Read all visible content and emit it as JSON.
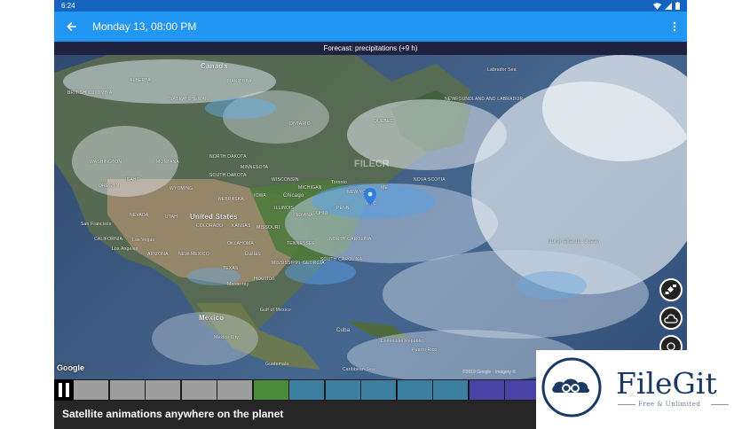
{
  "status_bar": {
    "time": "6:24"
  },
  "app_bar": {
    "title": "Monday 13, 08:00 PM"
  },
  "forecast_label": "Forecast: precipitations (+9 h)",
  "map": {
    "watermark": "FILECR",
    "google": "Google",
    "attribution": "©2019 Google · Imagery ©",
    "labels": {
      "canada": "Canada",
      "alberta": "ALBERTA",
      "manitoba": "MANITOBA",
      "saskatchewan": "SASKATCHEWAN",
      "british_columbia": "BRITISH COLUMBIA",
      "ontario": "ONTARIO",
      "quebec": "QUEBEC",
      "labrador_sea": "Labrador Sea",
      "newfoundland": "NEWFOUNDLAND AND LABRADOR",
      "washington": "WASHINGTON",
      "oregon": "OREGON",
      "montana": "MONTANA",
      "north_dakota": "NORTH DAKOTA",
      "minnesota": "MINNESOTA",
      "south_dakota": "SOUTH DAKOTA",
      "wisconsin": "WISCONSIN",
      "idaho": "IDAHO",
      "wyoming": "WYOMING",
      "nebraska": "NEBRASKA",
      "iowa": "IOWA",
      "michigan": "MICHIGAN",
      "toronto": "Toronto",
      "new_york": "NEW YORK",
      "nova_scotia": "NOVA SCOTIA",
      "maine": "ME",
      "nevada": "NEVADA",
      "utah": "UTAH",
      "colorado": "COLORADO",
      "kansas": "KANSAS",
      "missouri": "MISSOURI",
      "illinois": "ILLINOIS",
      "chicago": "Chicago",
      "indiana": "INDIANA",
      "ohio": "OHIO",
      "penn": "PENN",
      "nyc": "NYC",
      "united_states": "United States",
      "san_francisco": "San Francisco",
      "california": "CALIFORNIA",
      "las_vegas": "Las Vegas",
      "los_angeles": "Los Angeles",
      "arizona": "ARIZONA",
      "new_mexico": "NEW MEXICO",
      "oklahoma": "OKLAHOMA",
      "tennessee": "TENNESSEE",
      "north_carolina": "NORTH CAROLINA",
      "south_carolina": "SOUTH CAROLINA",
      "dallas": "Dallas",
      "texas": "TEXAS",
      "houston": "Houston",
      "georgia": "GEORGIA",
      "mississippi": "MISSISSIPPI",
      "north_atlantic": "North Atlantic Ocean",
      "monterrey": "Monterrey",
      "mexico_label": "Mexico",
      "gulf_of_mexico": "Gulf of Mexico",
      "mexico_city": "Mexico City",
      "cuba": "Cuba",
      "dominican": "Dominican Republic",
      "puerto_rico": "Puerto Rico",
      "guatemala": "Guatemala",
      "caribbean": "Caribbean Sea"
    }
  },
  "timeline": {
    "segments": [
      "#9e9e9e",
      "#9e9e9e",
      "#9e9e9e",
      "#9e9e9e",
      "#9e9e9e",
      "#4a8c3c",
      "#3c7fa0",
      "#3c7fa0",
      "#3c7fa0",
      "#3c7fa0",
      "#3c7fa0",
      "#4a44a8",
      "#4a44a8"
    ]
  },
  "caption": "Satellite animations anywhere on the planet",
  "filegit": {
    "name": "FileGit",
    "tagline": "Free & Unlimited"
  },
  "colors": {
    "appbar": "#2196f3",
    "statusbar": "#1565c0"
  }
}
